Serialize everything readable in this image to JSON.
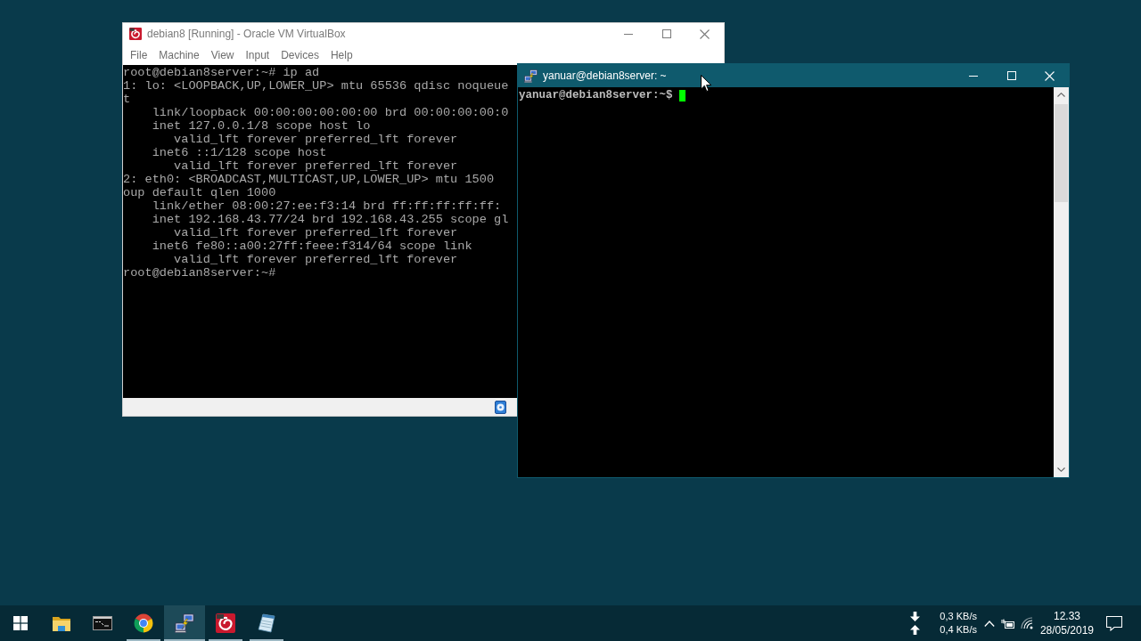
{
  "vbox_window": {
    "title": "debian8 [Running] - Oracle VM VirtualBox",
    "active": false,
    "menu": [
      "File",
      "Machine",
      "View",
      "Input",
      "Devices",
      "Help"
    ],
    "console_lines": [
      "root@debian8server:~# ip ad",
      "1: lo: <LOOPBACK,UP,LOWER_UP> mtu 65536 qdisc noqueue",
      "t",
      "    link/loopback 00:00:00:00:00:00 brd 00:00:00:00:0",
      "    inet 127.0.0.1/8 scope host lo",
      "       valid_lft forever preferred_lft forever",
      "    inet6 ::1/128 scope host",
      "       valid_lft forever preferred_lft forever",
      "2: eth0: <BROADCAST,MULTICAST,UP,LOWER_UP> mtu 1500",
      "oup default qlen 1000",
      "    link/ether 08:00:27:ee:f3:14 brd ff:ff:ff:ff:ff:",
      "    inet 192.168.43.77/24 brd 192.168.43.255 scope gl",
      "       valid_lft forever preferred_lft forever",
      "    inet6 fe80::a00:27ff:feee:f314/64 scope link",
      "       valid_lft forever preferred_lft forever",
      "root@debian8server:~#"
    ]
  },
  "putty_window": {
    "title": "yanuar@debian8server: ~",
    "active": true,
    "console_lines": [
      "yanuar@debian8server:~$"
    ],
    "cursor": true
  },
  "taskbar": {
    "apps": [
      {
        "kind": "folder",
        "running": false,
        "selected": false
      },
      {
        "kind": "console",
        "running": false,
        "selected": false
      },
      {
        "kind": "browser",
        "running": true,
        "selected": false
      },
      {
        "kind": "remote",
        "running": true,
        "selected": true
      },
      {
        "kind": "swirl",
        "running": true,
        "selected": false
      },
      {
        "kind": "notepad",
        "running": true,
        "selected": false
      }
    ]
  },
  "tray": {
    "download_rate": "0,3 KB/s",
    "upload_rate": "0,4 KB/s",
    "time": "12.33",
    "date": "28/05/2019"
  }
}
